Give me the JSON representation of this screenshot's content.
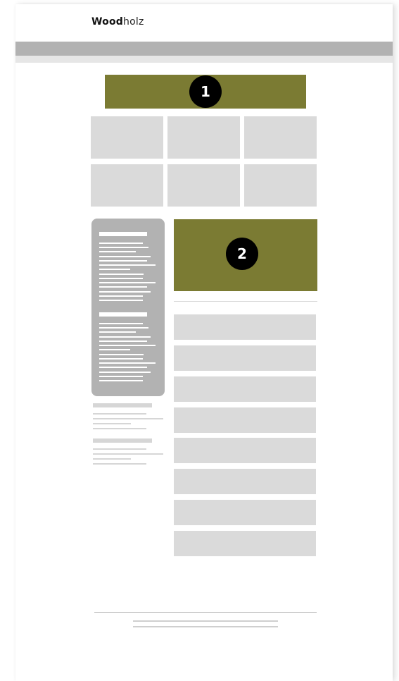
{
  "header": {
    "logo_bold": "Wood",
    "logo_light": "holz"
  },
  "hero": {
    "badge_number": "1"
  },
  "feature": {
    "badge_number": "2"
  },
  "colors": {
    "accent_olive": "#7b7b33",
    "placeholder_grey": "#dadada",
    "nav_grey": "#b2b2b2",
    "badge_black": "#000000"
  }
}
